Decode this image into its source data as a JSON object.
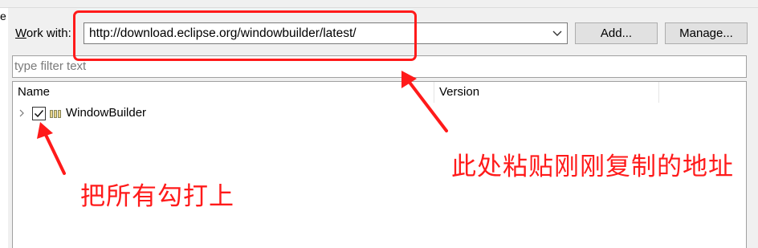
{
  "work_with": {
    "label_prefix": "W",
    "label_rest": "ork with:",
    "url": "http://download.eclipse.org/windowbuilder/latest/"
  },
  "buttons": {
    "add": "Add...",
    "manage": "Manage..."
  },
  "filter": {
    "placeholder": "type filter text"
  },
  "columns": {
    "name": "Name",
    "version": "Version"
  },
  "items": [
    {
      "label": "WindowBuilder",
      "checked": true,
      "version": ""
    }
  ],
  "annotations": {
    "url_note": "此处粘贴刚刚复制的地址",
    "check_note": "把所有勾打上",
    "color": "#ff1a1a"
  },
  "left_fragment": "e"
}
